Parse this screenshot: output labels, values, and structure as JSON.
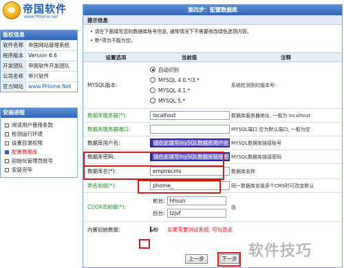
{
  "logo": {
    "title": "帝国软件",
    "url": "www.PHome.net"
  },
  "info_panel": {
    "title": "版权信息",
    "rows": [
      {
        "key": "软件名称",
        "value": "帝国网站管理系统"
      },
      {
        "key": "程序版本",
        "value": "Version 6.6"
      },
      {
        "key": "开发团队",
        "value": "帝国软件开发团队"
      },
      {
        "key": "公司名称",
        "value": "帝兴软件"
      },
      {
        "key": "官方网站",
        "value": "www.PHome.Net"
      }
    ]
  },
  "steps_panel": {
    "title": "安装进程",
    "items": [
      {
        "label": "阅读用户使用条款",
        "active": false
      },
      {
        "label": "检测运行环境",
        "active": false
      },
      {
        "label": "设置目录权限",
        "active": false
      },
      {
        "label": "配置数据库",
        "active": true
      },
      {
        "label": "初始化管理员账号",
        "active": false
      },
      {
        "label": "安装完毕",
        "active": false
      }
    ]
  },
  "main": {
    "title": "第四步：配置数据库",
    "tips_title": "提示信息",
    "tips": [
      "• 请在下面填写您的数据库账号信息, 通常情况下不需要修改绿色选项内容。",
      "• 带*项为不能为空。"
    ],
    "columns": [
      "设置选项",
      "当前值",
      "注释"
    ],
    "mysql": {
      "label": "MYSQL版本:",
      "options": [
        "自动识别",
        "MYSQL 4.0.*/3.*",
        "MYSQL 4.1.*",
        "MYSQL 5.*"
      ],
      "selected": 0,
      "note": "系统检测到的版本号:"
    },
    "fields": {
      "server": {
        "label": "数据库服务器(*):",
        "value": "localhost",
        "note": "数据库服务器地址, 一般为 localhost"
      },
      "port": {
        "label": "数据库服务器端口:",
        "value": "",
        "note": "MYSQL端口,空为默认端口, 一般为空"
      },
      "user": {
        "label": "数据库用户名:",
        "value": "请在此填写mySQL数据库用户名",
        "note": "MYSQL数据库链接账号"
      },
      "password": {
        "label": "数据库密码:",
        "value": "请在此填写mySQL数据库链接密码",
        "note": "MYSQL数据库链接密码"
      },
      "dbname": {
        "label": "数据库名(*):",
        "value": "empirecms",
        "note": "数据库名称"
      },
      "prefix": {
        "label": "表名前缀(*):",
        "value": "phome_",
        "note": "同一数据库安装多个CMS时可改变默认"
      },
      "cookie": {
        "label": "COOKIE前缀(*):",
        "front_label": "前台:",
        "front_value": "hhsun",
        "back_label": "后台:",
        "back_value": "tzjvf",
        "note": "由"
      },
      "init": {
        "label": "内置初始数据:",
        "checkbox_text": "是",
        "note": "如果需要测试系统, 可勾选此",
        "checked": true
      }
    },
    "buttons": {
      "prev": "上一步",
      "next": "下一步"
    }
  },
  "watermark": "软件技巧"
}
